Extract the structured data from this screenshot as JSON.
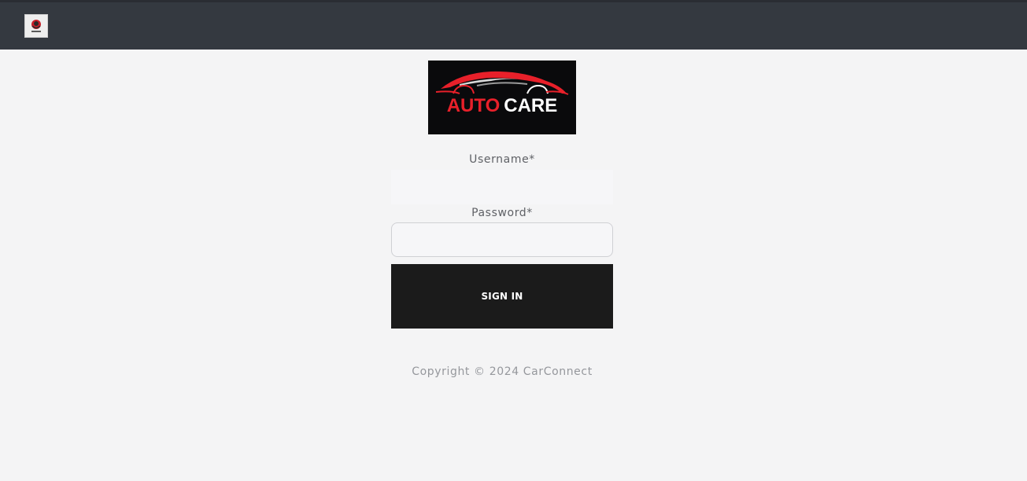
{
  "navbar": {
    "logo_icon": "autocare-badge-icon"
  },
  "logo": {
    "word_red": "AUTO",
    "word_white": "CARE",
    "colors": {
      "red": "#e8202a",
      "white": "#ffffff",
      "background": "#0a0a0c"
    }
  },
  "form": {
    "username_label": "Username*",
    "username_value": "",
    "password_label": "Password*",
    "password_value": "",
    "submit_label": "SIGN IN"
  },
  "footer": {
    "copyright": "Copyright © 2024 CarConnect"
  },
  "colors": {
    "topbar": "#343940",
    "page_background": "#f4f4f5",
    "button": "#1b1b1b"
  }
}
